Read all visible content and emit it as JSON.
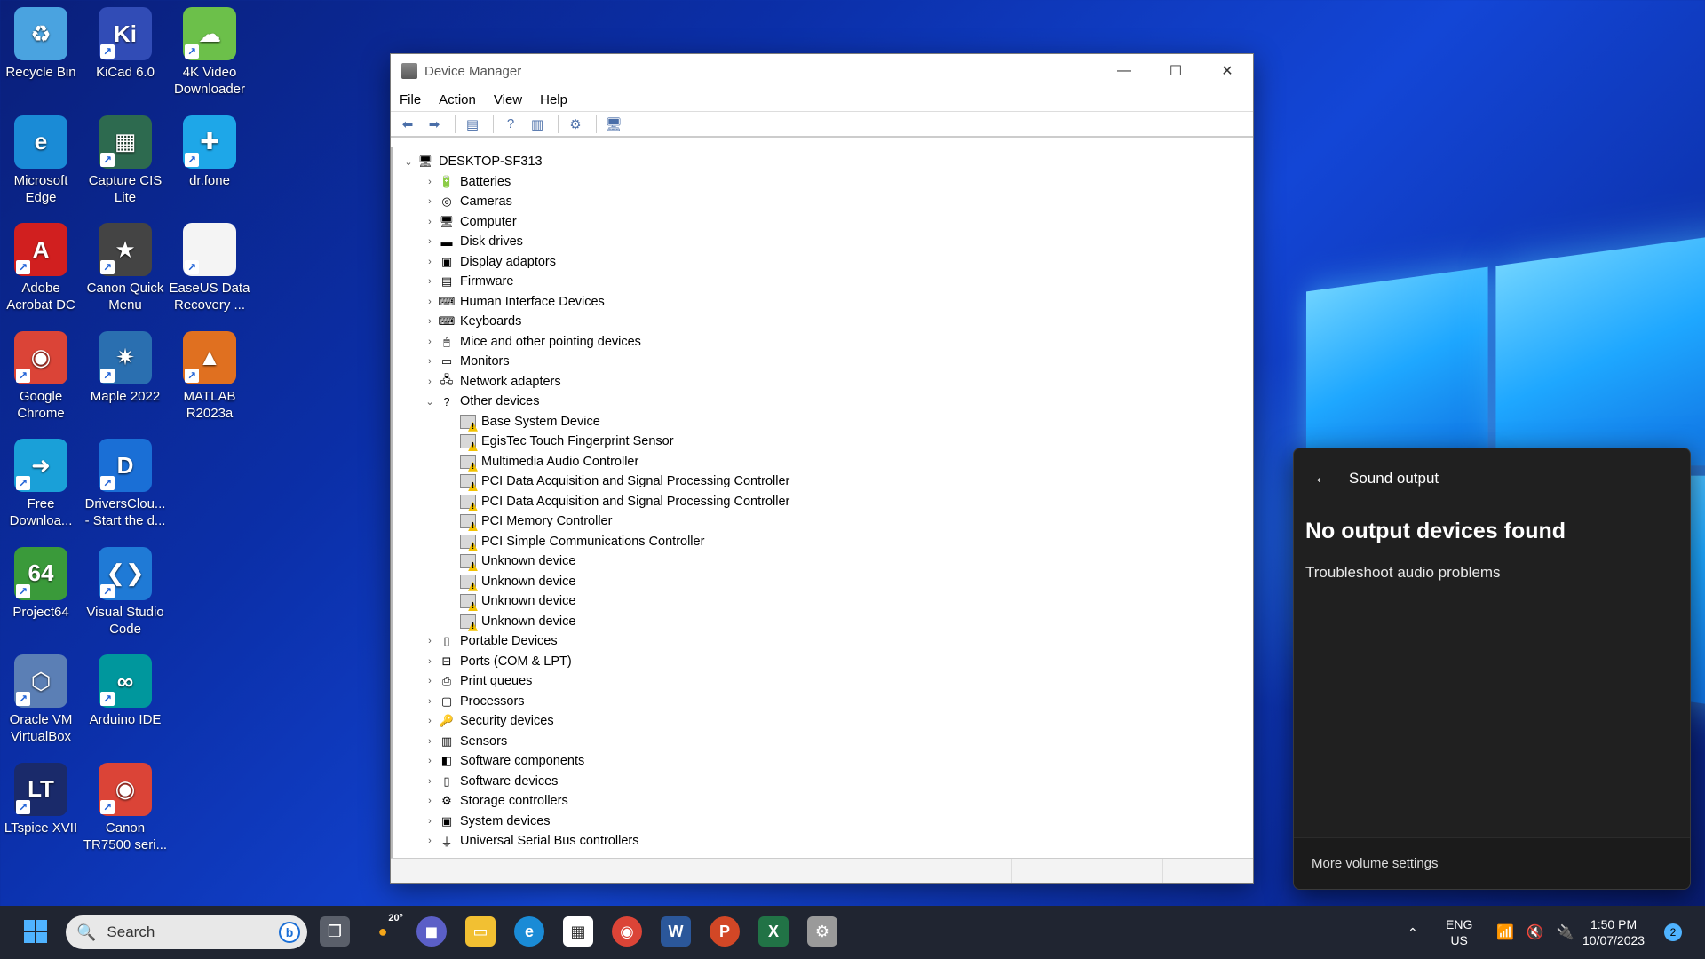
{
  "desktop_icons": [
    {
      "label": "Recycle Bin",
      "icon": "recycle-bin-icon",
      "color": "#4aa3e0",
      "glyph": "♻",
      "shortcut": false
    },
    {
      "label": "KiCad 6.0",
      "icon": "kicad-icon",
      "color": "#314cb6",
      "glyph": "Ki",
      "shortcut": true
    },
    {
      "label": "4K Video Downloader",
      "icon": "4k-video-downloader-icon",
      "color": "#6cc04a",
      "glyph": "☁",
      "shortcut": true
    },
    {
      "label": "Microsoft Edge",
      "icon": "edge-icon",
      "color": "#1a8bd6",
      "glyph": "e",
      "shortcut": false
    },
    {
      "label": "Capture CIS Lite",
      "icon": "capture-cis-icon",
      "color": "#2d6a4f",
      "glyph": "▦",
      "shortcut": true
    },
    {
      "label": "dr.fone",
      "icon": "drfone-icon",
      "color": "#1ea7e8",
      "glyph": "✚",
      "shortcut": true
    },
    {
      "label": "Adobe Acrobat DC",
      "icon": "acrobat-icon",
      "color": "#d11f1f",
      "glyph": "A",
      "shortcut": true
    },
    {
      "label": "Canon Quick Menu",
      "icon": "canon-quick-menu-icon",
      "color": "#444444",
      "glyph": "★",
      "shortcut": true
    },
    {
      "label": "EaseUS Data Recovery ...",
      "icon": "file-icon",
      "color": "#f4f4f4",
      "glyph": "",
      "shortcut": true
    },
    {
      "label": "Google Chrome",
      "icon": "chrome-icon",
      "color": "#db4437",
      "glyph": "◉",
      "shortcut": true
    },
    {
      "label": "Maple 2022",
      "icon": "maple-icon",
      "color": "#2a6fb0",
      "glyph": "✷",
      "shortcut": true
    },
    {
      "label": "MATLAB R2023a",
      "icon": "matlab-icon",
      "color": "#e07020",
      "glyph": "▲",
      "shortcut": true
    },
    {
      "label": "Free Downloa...",
      "icon": "free-download-icon",
      "color": "#1aa0d8",
      "glyph": "➜",
      "shortcut": true
    },
    {
      "label": "DriversClou... - Start the d...",
      "icon": "driverscloud-icon",
      "color": "#1a6fd6",
      "glyph": "D",
      "shortcut": true
    },
    {
      "label": "Project64",
      "icon": "project64-icon",
      "color": "#3a9a3a",
      "glyph": "64",
      "shortcut": true
    },
    {
      "label": "Visual Studio Code",
      "icon": "vscode-icon",
      "color": "#1f7ad6",
      "glyph": "❮❯",
      "shortcut": true
    },
    {
      "label": "Oracle VM VirtualBox",
      "icon": "virtualbox-icon",
      "color": "#5b7fb5",
      "glyph": "⬡",
      "shortcut": true
    },
    {
      "label": "Arduino IDE",
      "icon": "arduino-icon",
      "color": "#00979d",
      "glyph": "∞",
      "shortcut": true
    },
    {
      "label": "LTspice XVII",
      "icon": "ltspice-icon",
      "color": "#1a2a6a",
      "glyph": "LT",
      "shortcut": true
    },
    {
      "label": "Canon TR7500 seri...",
      "icon": "chrome-icon",
      "color": "#db4437",
      "glyph": "◉",
      "shortcut": true
    }
  ],
  "device_manager": {
    "title": "Device Manager",
    "window_controls": {
      "minimize": "—",
      "maximize": "☐",
      "close": "✕"
    },
    "menu": [
      "File",
      "Action",
      "View",
      "Help"
    ],
    "root": "DESKTOP-SF313",
    "categories_before": [
      {
        "label": "Batteries",
        "icon": "battery-icon",
        "glyph": "🔋"
      },
      {
        "label": "Cameras",
        "icon": "camera-icon",
        "glyph": "◎"
      },
      {
        "label": "Computer",
        "icon": "computer-icon",
        "glyph": "🖥"
      },
      {
        "label": "Disk drives",
        "icon": "disk-drive-icon",
        "glyph": "▬"
      },
      {
        "label": "Display adaptors",
        "icon": "display-adaptor-icon",
        "glyph": "▣"
      },
      {
        "label": "Firmware",
        "icon": "firmware-icon",
        "glyph": "▤"
      },
      {
        "label": "Human Interface Devices",
        "icon": "hid-icon",
        "glyph": "⌨"
      },
      {
        "label": "Keyboards",
        "icon": "keyboard-icon",
        "glyph": "⌨"
      },
      {
        "label": "Mice and other pointing devices",
        "icon": "mouse-icon",
        "glyph": "🖱"
      },
      {
        "label": "Monitors",
        "icon": "monitor-icon",
        "glyph": "▭"
      },
      {
        "label": "Network adapters",
        "icon": "network-adapter-icon",
        "glyph": "🖧"
      }
    ],
    "other_devices": {
      "label": "Other devices",
      "children": [
        "Base System Device",
        "EgisTec Touch Fingerprint Sensor",
        "Multimedia Audio Controller",
        "PCI Data Acquisition and Signal Processing Controller",
        "PCI Data Acquisition and Signal Processing Controller",
        "PCI Memory Controller",
        "PCI Simple Communications Controller",
        "Unknown device",
        "Unknown device",
        "Unknown device",
        "Unknown device"
      ]
    },
    "categories_after": [
      {
        "label": "Portable Devices",
        "icon": "portable-device-icon",
        "glyph": "▯"
      },
      {
        "label": "Ports (COM & LPT)",
        "icon": "port-icon",
        "glyph": "⊟"
      },
      {
        "label": "Print queues",
        "icon": "printer-icon",
        "glyph": "⎙"
      },
      {
        "label": "Processors",
        "icon": "processor-icon",
        "glyph": "▢"
      },
      {
        "label": "Security devices",
        "icon": "security-device-icon",
        "glyph": "🔑"
      },
      {
        "label": "Sensors",
        "icon": "sensor-icon",
        "glyph": "▥"
      },
      {
        "label": "Software components",
        "icon": "software-component-icon",
        "glyph": "◧"
      },
      {
        "label": "Software devices",
        "icon": "software-device-icon",
        "glyph": "▯"
      },
      {
        "label": "Storage controllers",
        "icon": "storage-controller-icon",
        "glyph": "⚙"
      },
      {
        "label": "System devices",
        "icon": "system-device-icon",
        "glyph": "▣"
      },
      {
        "label": "Universal Serial Bus controllers",
        "icon": "usb-icon",
        "glyph": "⏚"
      }
    ]
  },
  "sound_panel": {
    "title": "Sound output",
    "heading": "No output devices found",
    "troubleshoot": "Troubleshoot audio problems",
    "more_settings": "More volume settings"
  },
  "taskbar": {
    "search_placeholder": "Search",
    "weather_temp": "20°",
    "language_line1": "ENG",
    "language_line2": "US",
    "time": "1:50 PM",
    "date": "10/07/2023",
    "notification_count": "2"
  }
}
